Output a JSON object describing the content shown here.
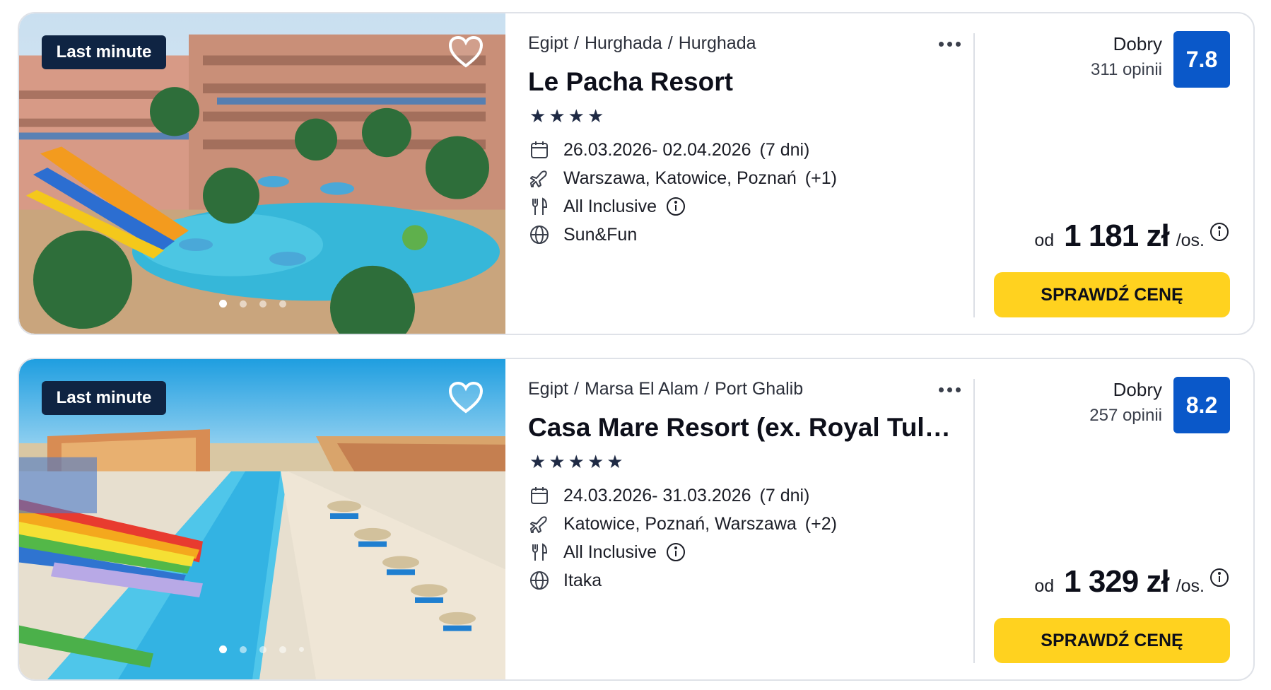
{
  "colors": {
    "badge_bg": "#0f2443",
    "rating_bg": "#0a58c9",
    "cta_bg": "#ffd21f",
    "border": "#dfe2e8"
  },
  "icons": [
    "heart-icon",
    "more-dots-icon",
    "calendar-icon",
    "airplane-icon",
    "cutlery-icon",
    "info-icon",
    "globe-icon",
    "star-icon"
  ],
  "offers": [
    {
      "badge": "Last minute",
      "breadcrumb": [
        "Egipt",
        "Hurghada",
        "Hurghada"
      ],
      "name": "Le Pacha Resort",
      "stars": 4,
      "dates": "26.03.2026- 02.04.2026",
      "duration": "(7 dni)",
      "airports": "Warszawa, Katowice, Poznań",
      "airports_extra": "(+1)",
      "board": "All Inclusive",
      "operator": "Sun&Fun",
      "rating_word": "Dobry",
      "rating_count": "311 opinii",
      "rating_score": "7.8",
      "price_from": "od",
      "price": "1 181 zł",
      "price_per": "/os.",
      "cta": "SPRAWDŹ CENĘ",
      "carousel_active_index": 0,
      "carousel_count": 4
    },
    {
      "badge": "Last minute",
      "breadcrumb": [
        "Egipt",
        "Marsa El Alam",
        "Port Ghalib"
      ],
      "name": "Casa Mare Resort (ex. Royal Tulip Beach Resort)",
      "stars": 5,
      "dates": "24.03.2026- 31.03.2026",
      "duration": "(7 dni)",
      "airports": "Katowice, Poznań, Warszawa",
      "airports_extra": "(+2)",
      "board": "All Inclusive",
      "operator": "Itaka",
      "rating_word": "Dobry",
      "rating_count": "257 opinii",
      "rating_score": "8.2",
      "price_from": "od",
      "price": "1 329 zł",
      "price_per": "/os.",
      "cta": "SPRAWDŹ CENĘ",
      "carousel_active_index": 0,
      "carousel_count": 5
    }
  ]
}
